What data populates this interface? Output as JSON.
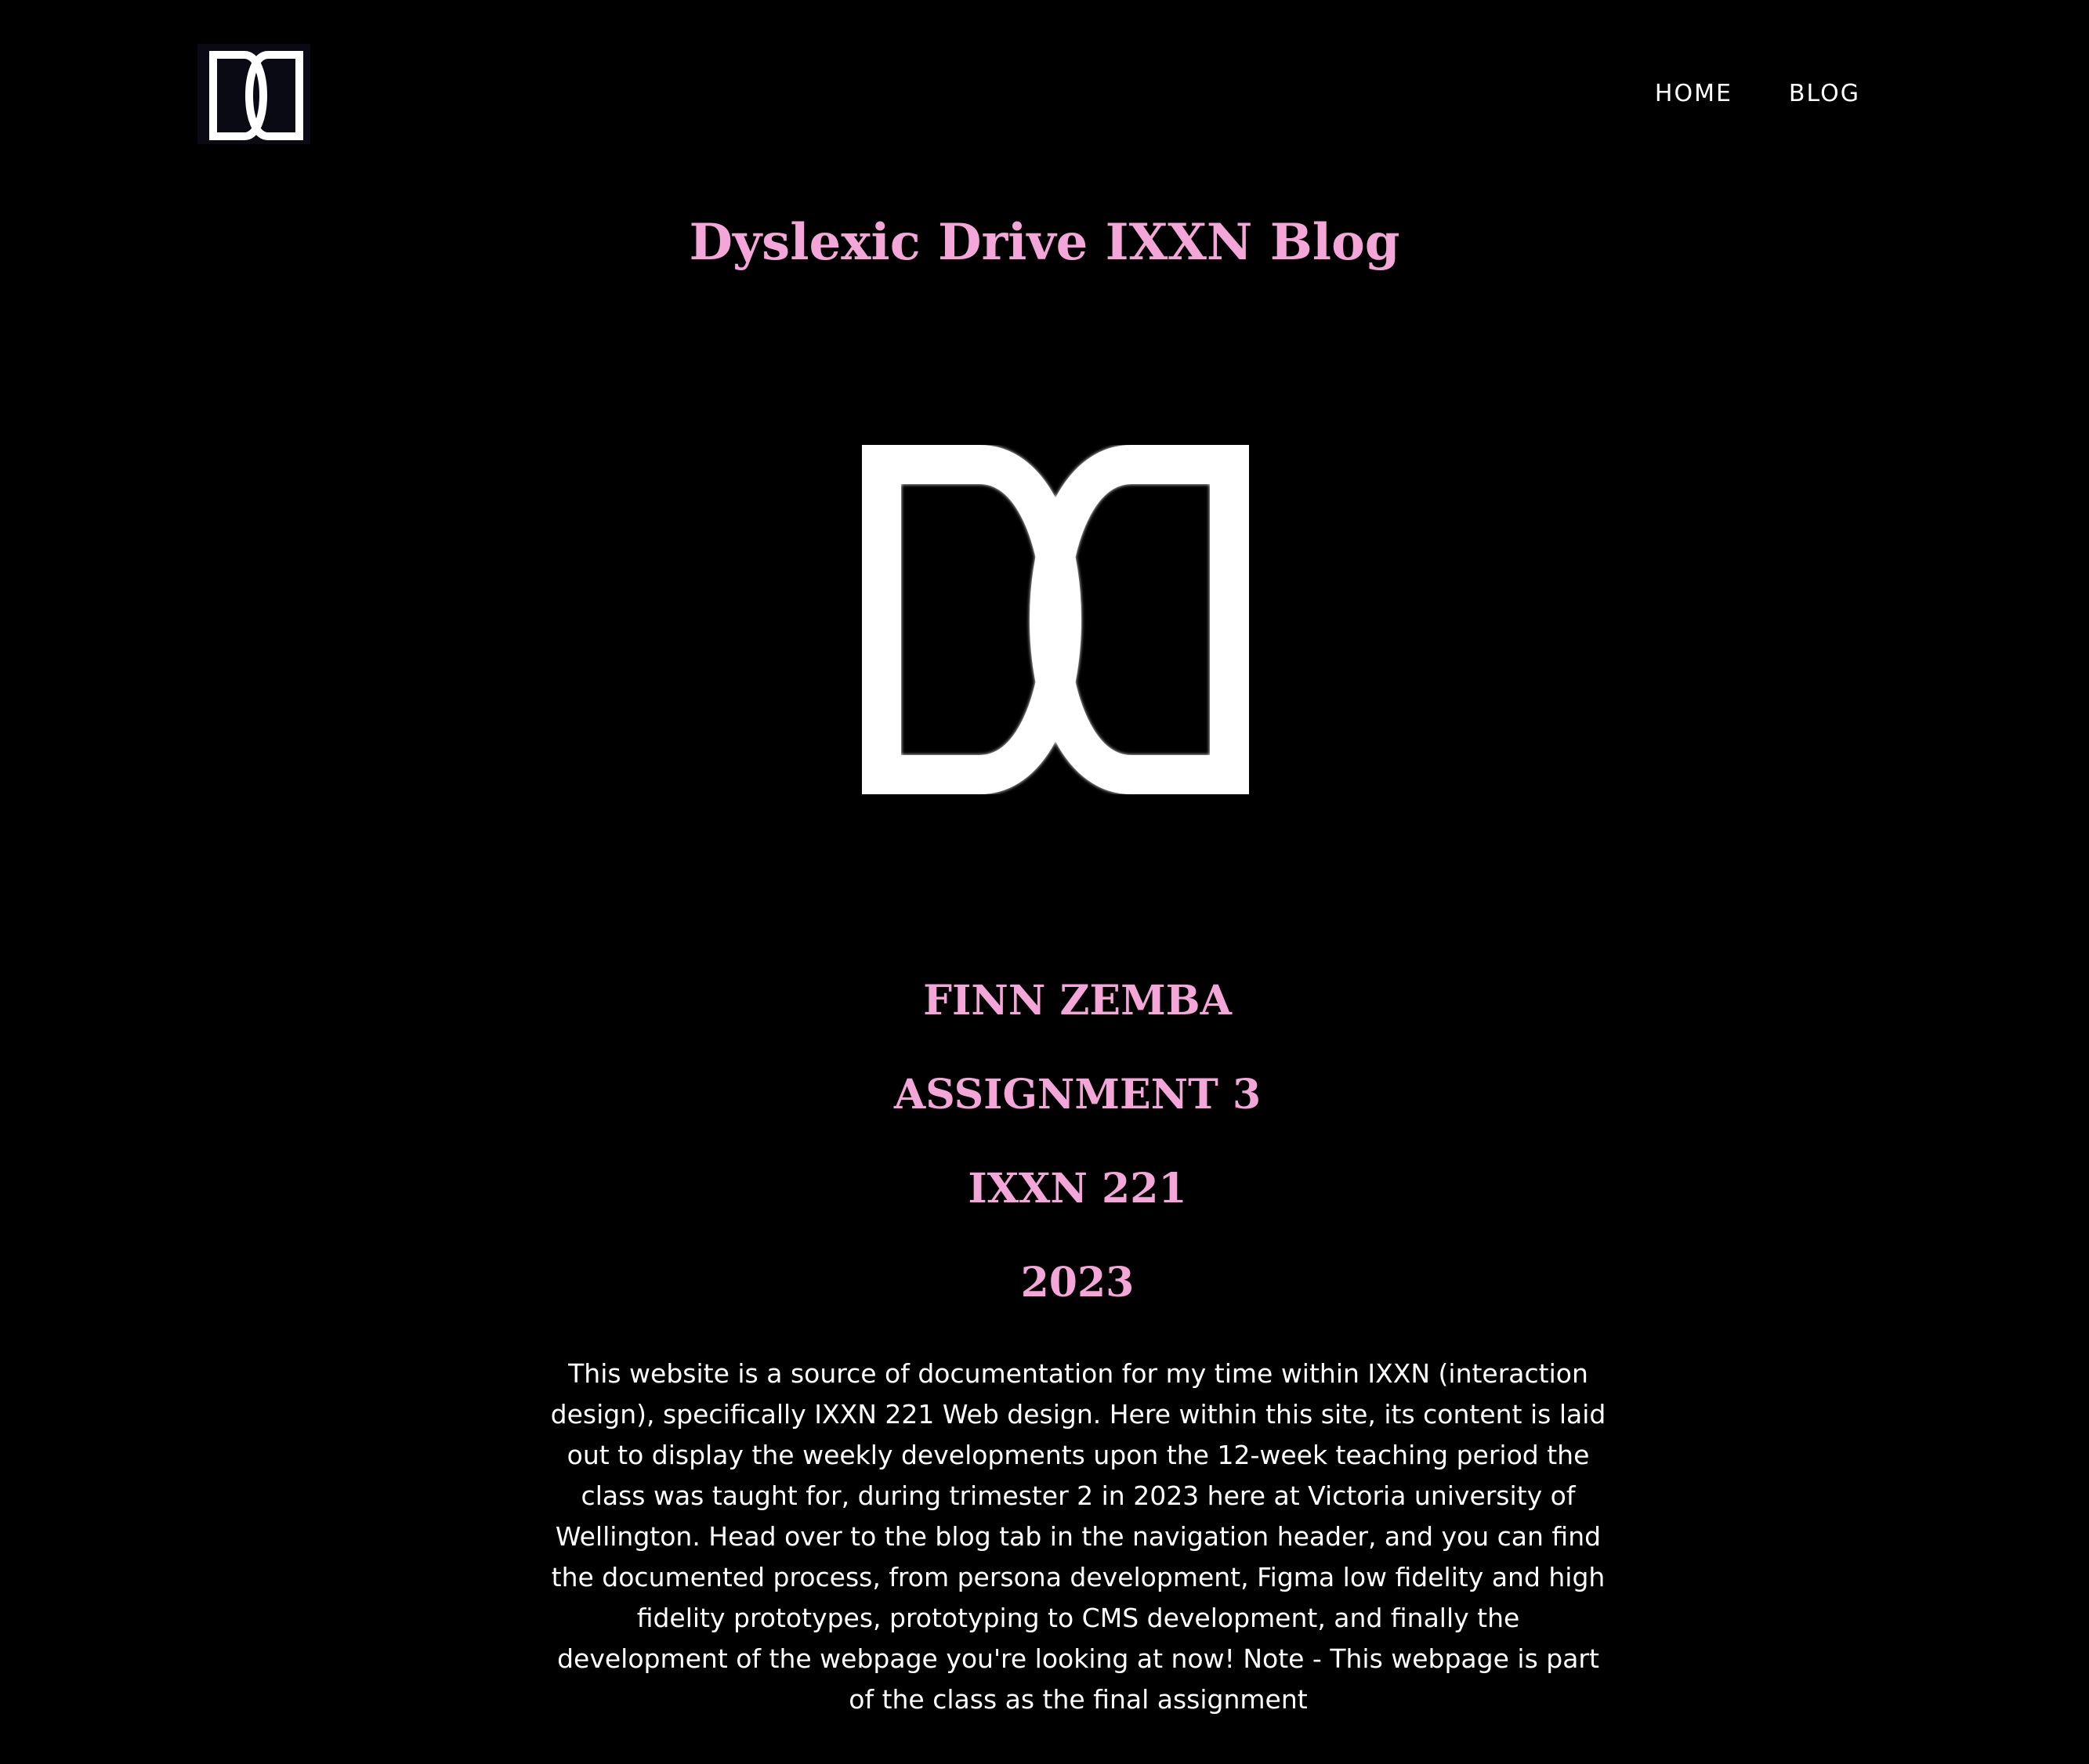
{
  "header": {
    "logo_icon": "double-d-logo-icon",
    "nav": [
      {
        "label": "HOME"
      },
      {
        "label": "BLOG"
      }
    ]
  },
  "main": {
    "title": "Dyslexic Drive IXXN Blog",
    "hero_icon": "double-d-logo-icon",
    "headings": [
      "FINN ZEMBA",
      "ASSIGNMENT 3",
      "IXXN 221",
      "2023"
    ],
    "intro": "This website is a source of documentation for my time within IXXN (interaction design), specifically IXXN 221 Web design. Here within this site, its content is laid out to display the weekly developments upon the 12-week teaching period the class was taught for, during trimester 2 in 2023 here at Victoria university of Wellington. Head over to the blog tab in the navigation header, and you can find the documented process, from persona development, Figma low fidelity and high fidelity prototypes, prototyping to CMS development, and finally the development of the webpage you're looking at now! Note - This webpage is part of the class as the final assignment"
  },
  "colors": {
    "background": "#000000",
    "accent_pink": "#f3a6d7",
    "text": "#ffffff"
  }
}
